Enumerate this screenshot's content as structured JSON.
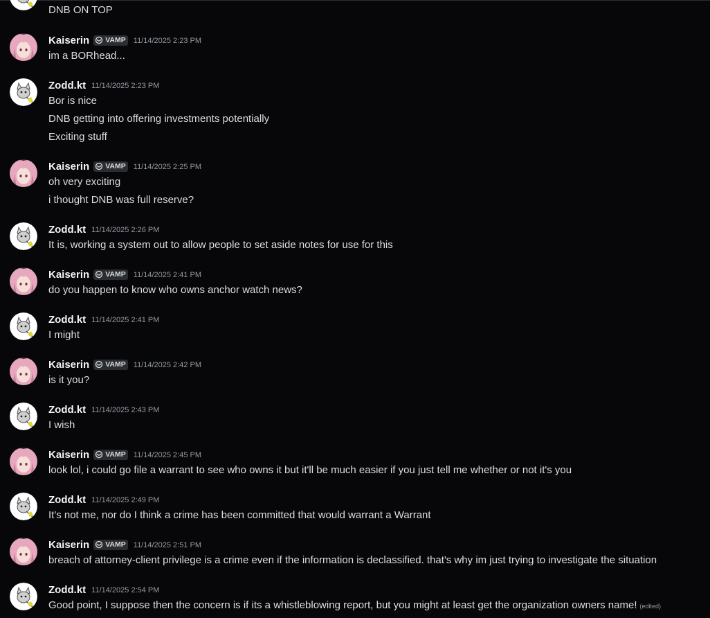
{
  "messages": [
    {
      "user": "",
      "avatar": "zodd",
      "lines": [
        "DNB ON TOP"
      ]
    },
    {
      "user": "Kaiserin",
      "avatar": "kaiserin",
      "tag": "VAMP",
      "time": "11/14/2025 2:23 PM",
      "lines": [
        "im a BORhead..."
      ]
    },
    {
      "user": "Zodd.kt",
      "avatar": "zodd",
      "time": "11/14/2025 2:23 PM",
      "lines": [
        "Bor is nice",
        "DNB getting into offering investments potentially",
        "Exciting stuff"
      ]
    },
    {
      "user": "Kaiserin",
      "avatar": "kaiserin",
      "tag": "VAMP",
      "time": "11/14/2025 2:25 PM",
      "lines": [
        "oh very exciting",
        "i thought DNB was full reserve?"
      ]
    },
    {
      "user": "Zodd.kt",
      "avatar": "zodd",
      "time": "11/14/2025 2:26 PM",
      "lines": [
        "It is, working a system out to allow people to set aside notes for use for this"
      ]
    },
    {
      "user": "Kaiserin",
      "avatar": "kaiserin",
      "tag": "VAMP",
      "time": "11/14/2025 2:41 PM",
      "lines": [
        "do you happen to know who owns anchor watch news?"
      ]
    },
    {
      "user": "Zodd.kt",
      "avatar": "zodd",
      "time": "11/14/2025 2:41 PM",
      "lines": [
        "I might"
      ]
    },
    {
      "user": "Kaiserin",
      "avatar": "kaiserin",
      "tag": "VAMP",
      "time": "11/14/2025 2:42 PM",
      "lines": [
        "is it you?"
      ]
    },
    {
      "user": "Zodd.kt",
      "avatar": "zodd",
      "time": "11/14/2025 2:43 PM",
      "lines": [
        "I wish"
      ]
    },
    {
      "user": "Kaiserin",
      "avatar": "kaiserin",
      "tag": "VAMP",
      "time": "11/14/2025 2:45 PM",
      "lines": [
        "look lol, i could go file a warrant to see who owns it but it'll be much easier if you just tell me whether or not it's you"
      ]
    },
    {
      "user": "Zodd.kt",
      "avatar": "zodd",
      "time": "11/14/2025 2:49 PM",
      "lines": [
        "It's not me, nor do I think a crime has been committed that would warrant a Warrant"
      ]
    },
    {
      "user": "Kaiserin",
      "avatar": "kaiserin",
      "tag": "VAMP",
      "time": "11/14/2025 2:51 PM",
      "lines": [
        "breach of attorney-client privilege is a crime even if the information is declassified. that's why im just trying to investigate the situation"
      ]
    },
    {
      "user": "Zodd.kt",
      "avatar": "zodd",
      "time": "11/14/2025 2:54 PM",
      "lines": [
        "Good point, I suppose then the concern is if its a whistleblowing report, but you might at least get the organization owners name!"
      ],
      "edited": "(edited)"
    }
  ]
}
